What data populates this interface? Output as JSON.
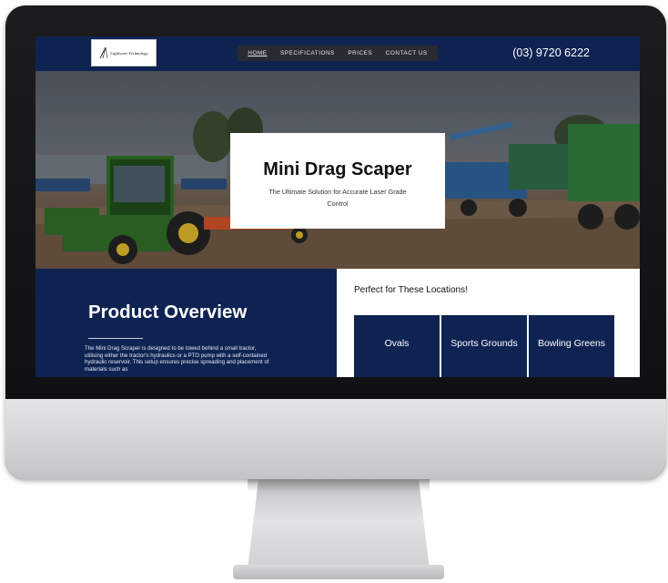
{
  "site": {
    "logo_text": "Lightware Technology"
  },
  "nav": {
    "items": [
      {
        "label": "HOME",
        "active": true
      },
      {
        "label": "SPECIFICATIONS",
        "active": false
      },
      {
        "label": "PRICES",
        "active": false
      },
      {
        "label": "CONTACT US",
        "active": false
      }
    ]
  },
  "header": {
    "phone": "(03) 9720 6222"
  },
  "hero": {
    "title": "Mini Drag Scaper",
    "subtitle": "The Ultimate Solution for Accurate Laser Grade Control"
  },
  "overview": {
    "title": "Product Overview",
    "body": "The Mini Drag Scraper is designed to be towed behind a small tractor, utilising either the tractor's hydraulics or a PTO pump with a self-contained hydraulic reservoir. This setup ensures precise spreading and placement of materials such as"
  },
  "locations": {
    "title": "Perfect for These Locations!",
    "items": [
      "Ovals",
      "Sports Grounds",
      "Bowling Greens"
    ]
  },
  "colors": {
    "brand_navy": "#0f2353",
    "nav_bar": "#2a2a33"
  }
}
